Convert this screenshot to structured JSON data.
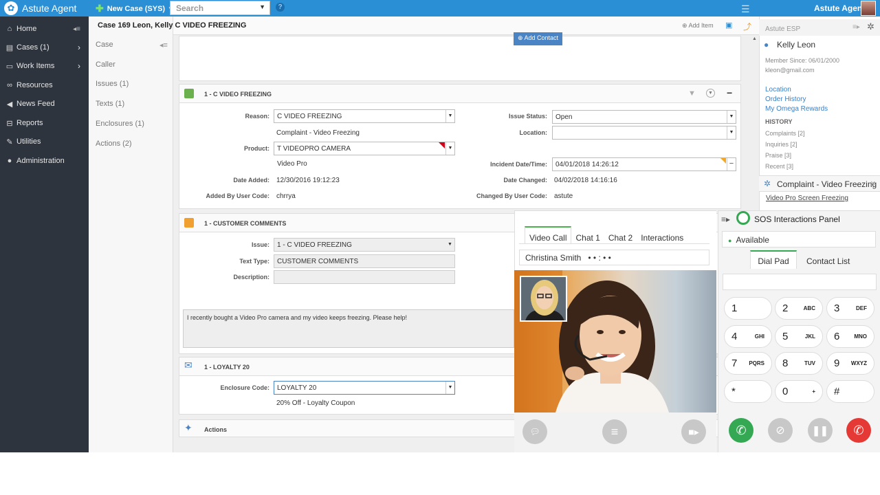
{
  "topbar": {
    "brand": "Astute Agent",
    "new_case": "New Case (SYS)",
    "search_placeholder": "Search",
    "agent_name": "Astute Agent"
  },
  "nav": [
    {
      "label": "Home",
      "icon": "home-icon"
    },
    {
      "label": "Cases (1)",
      "icon": "file-icon"
    },
    {
      "label": "Work Items",
      "icon": "inbox-icon"
    },
    {
      "label": "Resources",
      "icon": "link-icon"
    },
    {
      "label": "News Feed",
      "icon": "megaphone-icon"
    },
    {
      "label": "Reports",
      "icon": "report-icon"
    },
    {
      "label": "Utilities",
      "icon": "wrench-icon"
    },
    {
      "label": "Administration",
      "icon": "user-icon"
    }
  ],
  "subnav": [
    "Case",
    "Caller",
    "Issues (1)",
    "Texts (1)",
    "Enclosures (1)",
    "Actions (2)"
  ],
  "case": {
    "title": "Case 169 Leon, Kelly C VIDEO FREEZING",
    "add_item": "Add Item",
    "add_contact": "Add Contact"
  },
  "issue": {
    "header": "1 - C VIDEO FREEZING",
    "reason_label": "Reason:",
    "reason": "C VIDEO FREEZING",
    "reason_desc": "Complaint - Video Freezing",
    "product_label": "Product:",
    "product": "T VIDEOPRO CAMERA",
    "product_desc": "Video Pro",
    "date_added_label": "Date Added:",
    "date_added": "12/30/2016 19:12:23",
    "added_by_label": "Added By User Code:",
    "added_by": "chrrya",
    "status_label": "Issue Status:",
    "status": "Open",
    "location_label": "Location:",
    "location": "",
    "incident_label": "Incident Date/Time:",
    "incident": "04/01/2018 14:26:12",
    "date_changed_label": "Date Changed:",
    "date_changed": "04/02/2018 14:16:16",
    "changed_by_label": "Changed By User Code:",
    "changed_by": "astute"
  },
  "comments": {
    "header": "1 - CUSTOMER COMMENTS",
    "issue_label": "Issue:",
    "issue": "1 - C VIDEO FREEZING",
    "text_type_label": "Text Type:",
    "text_type": "CUSTOMER COMMENTS",
    "description_label": "Description:",
    "text": "I recently bought a Video Pro camera and my video keeps freezing. Please help!"
  },
  "loyalty": {
    "header": "1 - LOYALTY 20",
    "code_label": "Enclosure Code:",
    "code": "LOYALTY 20",
    "desc": "20% Off - Loyalty Coupon"
  },
  "actions": {
    "header": "Actions"
  },
  "right": {
    "esp": "Astute ESP",
    "customer": "Kelly Leon",
    "member_since": "Member Since: 06/01/2000",
    "email": "kleon@gmail.com",
    "links": [
      "Location",
      "Order History",
      "My Omega Rewards"
    ],
    "history_title": "HISTORY",
    "history": [
      "Complaints [2]",
      "Inquiries [2]",
      "Praise [3]",
      "Recent [3]"
    ],
    "complaint": "Complaint - Video Freezing",
    "kb_link": "Video Pro Screen Freezing"
  },
  "video": {
    "tabs": [
      "Video Call",
      "Chat 1",
      "Chat 2",
      "Interactions"
    ],
    "caller": "Christina Smith",
    "dots": "• • : • •"
  },
  "sos": {
    "title": "SOS Interactions Panel",
    "status": "Available",
    "tabs": [
      "Dial Pad",
      "Contact List"
    ],
    "keys": [
      {
        "n": "1",
        "s": ""
      },
      {
        "n": "2",
        "s": "ABC"
      },
      {
        "n": "3",
        "s": "DEF"
      },
      {
        "n": "4",
        "s": "GHI"
      },
      {
        "n": "5",
        "s": "JKL"
      },
      {
        "n": "6",
        "s": "MNO"
      },
      {
        "n": "7",
        "s": "PQRS"
      },
      {
        "n": "8",
        "s": "TUV"
      },
      {
        "n": "9",
        "s": "WXYZ"
      },
      {
        "n": "*",
        "s": ""
      },
      {
        "n": "0",
        "s": "+"
      },
      {
        "n": "#",
        "s": ""
      }
    ]
  },
  "colors": {
    "topbar": "#2b8fd6",
    "sidenav": "#2e343e",
    "call": "#34a853",
    "hangup": "#e53935"
  }
}
